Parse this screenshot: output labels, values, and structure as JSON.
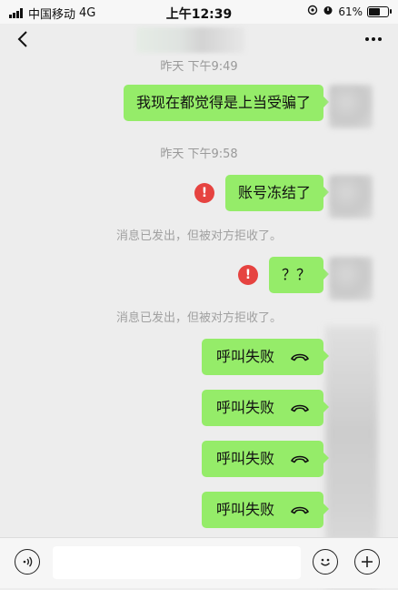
{
  "status_bar": {
    "carrier": "中国移动",
    "network": "4G",
    "time": "上午12:39",
    "battery_percent": "61%",
    "battery_level": 0.61
  },
  "nav": {
    "back_icon": "chevron-left-icon",
    "more_icon": "ellipsis-icon"
  },
  "messages": {
    "top_time": "昨天 下午9:49",
    "msg1": "我现在都觉得是上当受骗了",
    "time2": "昨天 下午9:58",
    "msg2": "账号冻结了",
    "error_mark": "!",
    "rejected_notice_1": "消息已发出，但被对方拒收了。",
    "msg3": "？？",
    "rejected_notice_2": "消息已发出，但被对方拒收了。",
    "calls": [
      {
        "label": "呼叫失败"
      },
      {
        "label": "呼叫失败"
      },
      {
        "label": "呼叫失败"
      },
      {
        "label": "呼叫失败"
      }
    ]
  },
  "input_bar": {
    "voice_icon": "voice-icon",
    "emoji_icon": "emoji-icon",
    "plus_icon": "plus-icon",
    "text_value": ""
  },
  "colors": {
    "bubble": "#95ec69",
    "background": "#ededed",
    "error": "#e64340"
  }
}
